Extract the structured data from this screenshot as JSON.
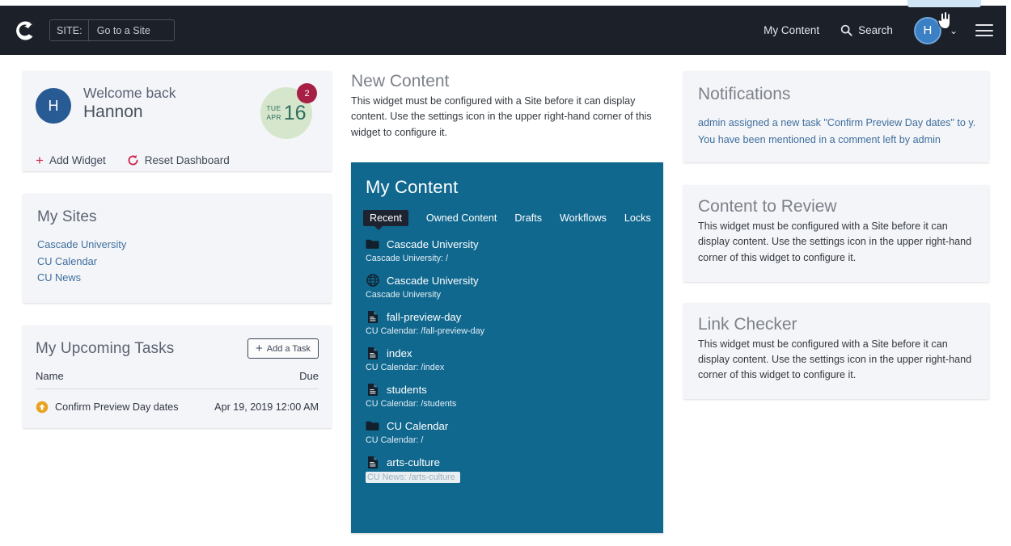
{
  "header": {
    "logo_icon": "cascade-crescent-logo",
    "site_label": "SITE:",
    "site_placeholder": "Go to a Site",
    "site_value": "Go to a Site",
    "my_content": "My Content",
    "search": "Search",
    "search_icon": "search-icon",
    "avatar_initial": "H",
    "chevron": "⌄",
    "menu_icon": "hamburger-menu-icon",
    "bg_color": "#1c2029"
  },
  "welcome": {
    "avatar_initial": "H",
    "greeting": "Welcome back",
    "name": "Hannon",
    "date_dow": "TUE",
    "date_mon": "APR",
    "date_day": "16",
    "date_badge_count": "2",
    "add_widget": "Add Widget",
    "add_widget_icon": "plus-icon",
    "reset_dashboard": "Reset Dashboard",
    "reset_icon": "refresh-icon",
    "accent_color": "#d11f4a",
    "badge_color": "#a81f45",
    "date_circle_color": "#d5e6cd"
  },
  "my_sites": {
    "title": "My Sites",
    "items": [
      {
        "label": "Cascade University"
      },
      {
        "label": "CU Calendar"
      },
      {
        "label": "CU News"
      }
    ]
  },
  "tasks": {
    "title": "My Upcoming Tasks",
    "add_button": "Add a Task",
    "add_button_icon": "plus-icon",
    "columns": {
      "name": "Name",
      "due": "Due"
    },
    "rows": [
      {
        "icon": "priority-up-arrow-icon",
        "icon_color": "#e8a321",
        "name": "Confirm Preview Day dates",
        "due": "Apr 19, 2019 12:00 AM"
      }
    ]
  },
  "new_content": {
    "title": "New Content",
    "body": "This widget must be configured with a Site before it can display content. Use the settings icon in the upper right-hand corner of this widget to configure it."
  },
  "my_content": {
    "title": "My Content",
    "panel_color": "#10688f",
    "tabs": [
      {
        "label": "Recent",
        "active": true
      },
      {
        "label": "Owned Content",
        "active": false
      },
      {
        "label": "Drafts",
        "active": false
      },
      {
        "label": "Workflows",
        "active": false
      },
      {
        "label": "Locks",
        "active": false
      }
    ],
    "items": [
      {
        "icon": "folder-icon",
        "name": "Cascade University",
        "path": "Cascade University: /",
        "highlighted": false
      },
      {
        "icon": "globe-icon",
        "name": "Cascade University",
        "path": "Cascade University",
        "highlighted": false
      },
      {
        "icon": "page-icon",
        "name": "fall-preview-day",
        "path": "CU Calendar: /fall-preview-day",
        "highlighted": false
      },
      {
        "icon": "page-icon",
        "name": "index",
        "path": "CU Calendar: /index",
        "highlighted": false
      },
      {
        "icon": "page-icon",
        "name": "students",
        "path": "CU Calendar: /students",
        "highlighted": false
      },
      {
        "icon": "folder-icon",
        "name": "CU Calendar",
        "path": "CU Calendar: /",
        "highlighted": false
      },
      {
        "icon": "page-icon",
        "name": "arts-culture",
        "path": "CU News: /arts-culture",
        "highlighted": true
      }
    ]
  },
  "notifications": {
    "title": "Notifications",
    "items": [
      {
        "text": "admin assigned a new task \"Confirm Preview Day dates\" to y..."
      },
      {
        "text": "You have been mentioned in a comment left by admin"
      }
    ]
  },
  "content_to_review": {
    "title": "Content to Review",
    "body": "This widget must be configured with a Site before it can display content. Use the settings icon in the upper right-hand corner of this widget to configure it."
  },
  "link_checker": {
    "title": "Link Checker",
    "body": "This widget must be configured with a Site before it can display content. Use the settings icon in the upper right-hand corner of this widget to configure it."
  }
}
